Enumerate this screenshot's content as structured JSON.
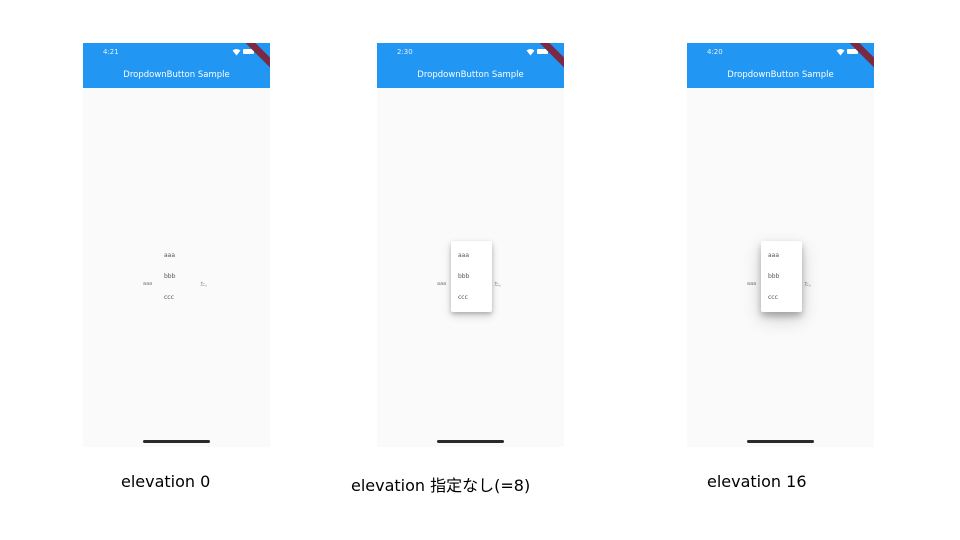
{
  "screens": [
    {
      "status_time": "4:21",
      "title": "DropdownButton Sample",
      "dropdown_value": "aaa",
      "dropdown_suffix": "た。",
      "menu_items": [
        "aaa",
        "bbb",
        "ccc"
      ],
      "menu_elevation": 0,
      "caption": "elevation 0"
    },
    {
      "status_time": "2:30",
      "title": "DropdownButton Sample",
      "dropdown_value": "aaa",
      "dropdown_suffix": "た。",
      "menu_items": [
        "aaa",
        "bbb",
        "ccc"
      ],
      "menu_elevation": 8,
      "caption": "elevation 指定なし(=8)"
    },
    {
      "status_time": "4:20",
      "title": "DropdownButton Sample",
      "dropdown_value": "aaa",
      "dropdown_suffix": "た。",
      "menu_items": [
        "aaa",
        "bbb",
        "ccc"
      ],
      "menu_elevation": 16,
      "caption": "elevation 16"
    }
  ],
  "colors": {
    "appbar": "#2196f3",
    "body": "#fafafa",
    "ribbon": "#7b2a44"
  },
  "icons": [
    "wifi-icon",
    "battery-icon",
    "dropdown-arrow-icon"
  ]
}
